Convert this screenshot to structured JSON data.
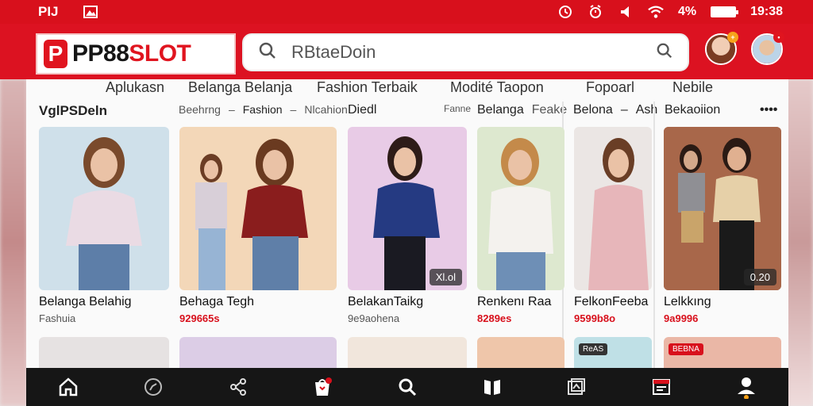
{
  "status": {
    "left_text": "PIJ",
    "battery": "4%",
    "time": "19:38"
  },
  "header": {
    "logo_text_black": "PP88",
    "logo_text_red": "SLOT",
    "search_placeholder": "RBtaeDoin"
  },
  "nav_tabs": [
    "Aplukasn",
    "Belanga Belanja",
    "Fashion Terbaik",
    "Modité Taopon",
    "Fopoarl",
    "Nebile"
  ],
  "sub_header": {
    "section_title": "VglPSDeln",
    "breadcrumb_1": "Beehrng",
    "breadcrumb_2": "Fashion",
    "breadcrumb_3": "Nlcahion",
    "col3_title": "Diedl",
    "col3_more": "Fanne",
    "col4_title": "Belanga",
    "col4_title2": "Feake",
    "col5_title": "Belona",
    "col5_title2": "Ash",
    "col6_title": "Bekaoiion",
    "more": "••••"
  },
  "products": [
    {
      "name": "Belanga Belahig",
      "sub": "Fashuia",
      "price": "",
      "tag": "",
      "bg": "#cfe0ea"
    },
    {
      "name": "Behaga Tegh",
      "sub": "",
      "price": "929665s",
      "tag": "",
      "bg": "#f3d7b8"
    },
    {
      "name": "BelakanTaikg",
      "sub": "9e9aohena",
      "price": "",
      "tag": "Xl.ol",
      "bg": "#e8cbe6"
    },
    {
      "name": "Renkenı Raa",
      "sub": "",
      "price": "8289es",
      "tag": "",
      "bg": "#dde8cf"
    },
    {
      "name": "FelkonFeeba",
      "sub": "",
      "price": "9599b8o",
      "tag": "",
      "bg": "#ebe6e4"
    },
    {
      "name": "Lelkkıng",
      "sub": "",
      "price": "9a9996",
      "tag": "0.20",
      "bg": "#9c5a3c"
    }
  ],
  "row2_tags": [
    "ReAS",
    "BEBNA"
  ],
  "colors": {
    "brand_red": "#d8101c",
    "nav_dark": "#161616"
  },
  "icons": [
    "home-icon",
    "discover-icon",
    "share-icon",
    "bag-icon",
    "search-icon",
    "book-icon",
    "gallery-icon",
    "news-icon",
    "profile-icon"
  ]
}
